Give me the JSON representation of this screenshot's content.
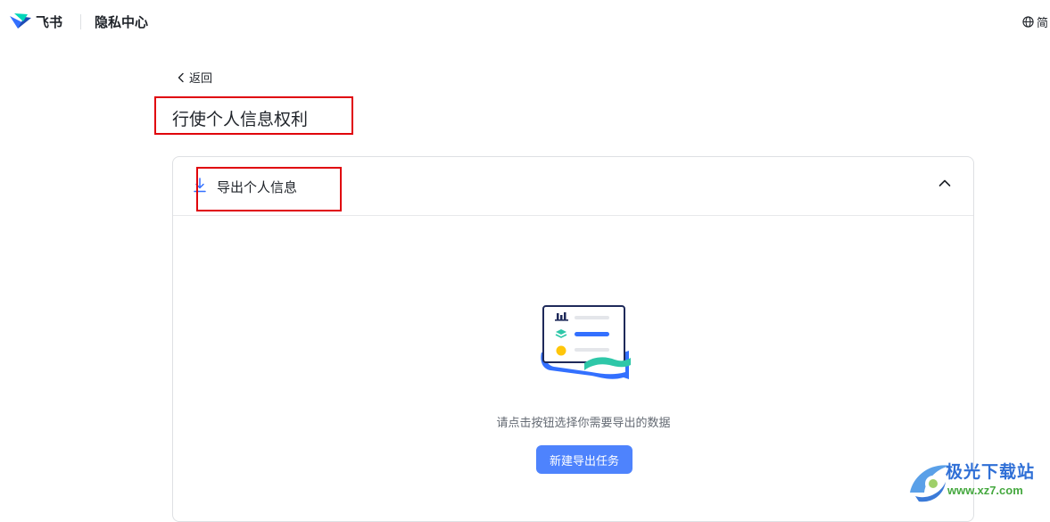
{
  "header": {
    "brand": "飞书",
    "section": "隐私中心",
    "language_label": "简"
  },
  "nav": {
    "back_label": "返回"
  },
  "page": {
    "title": "行使个人信息权利"
  },
  "export_panel": {
    "title": "导出个人信息",
    "expanded": true,
    "hint": "请点击按钮选择你需要导出的数据",
    "button_label": "新建导出任务"
  },
  "watermark": {
    "name": "极光下载站",
    "url": "www.xz7.com"
  },
  "colors": {
    "accent": "#4e83fd",
    "annotation_red": "#e0000b",
    "text_primary": "#1f2329",
    "text_secondary": "#646a73",
    "border": "#dee0e3"
  },
  "icons": {
    "logo": "feishu-logo",
    "language": "globe-icon",
    "back": "chevron-left-icon",
    "export": "download-icon",
    "collapse": "chevron-up-icon",
    "empty_state": "data-export-illustration"
  }
}
